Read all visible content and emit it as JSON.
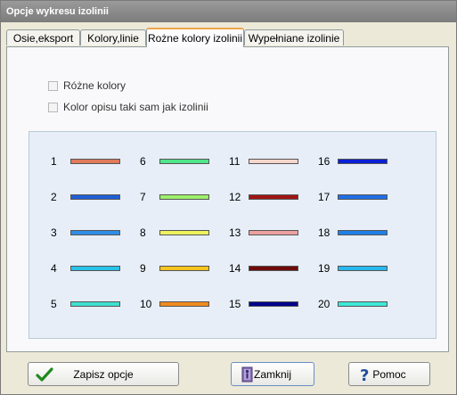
{
  "window": {
    "title": "Opcje wykresu izolinii"
  },
  "tabs": [
    {
      "label": "Osie,eksport",
      "active": false
    },
    {
      "label": "Kolory,linie",
      "active": false
    },
    {
      "label": "Rożne kolory izolinii",
      "active": true
    },
    {
      "label": "Wypełniane izolinie",
      "active": false
    }
  ],
  "options": {
    "different_colors": {
      "label": "Różne kolory",
      "checked": false
    },
    "label_color_same": {
      "label": "Kolor opisu taki sam jak izolinii",
      "checked": false
    }
  },
  "swatches": [
    {
      "num": "1",
      "color": "#e07a5a"
    },
    {
      "num": "2",
      "color": "#1f5fd6"
    },
    {
      "num": "3",
      "color": "#2f8ee6"
    },
    {
      "num": "4",
      "color": "#27c3e8"
    },
    {
      "num": "5",
      "color": "#3ee0d0"
    },
    {
      "num": "6",
      "color": "#4fe58a"
    },
    {
      "num": "7",
      "color": "#9ef06a"
    },
    {
      "num": "8",
      "color": "#eef25c"
    },
    {
      "num": "9",
      "color": "#f5c51e"
    },
    {
      "num": "10",
      "color": "#f08a1e"
    },
    {
      "num": "11",
      "color": "#f6d6cc"
    },
    {
      "num": "12",
      "color": "#a01515"
    },
    {
      "num": "13",
      "color": "#eda0a0"
    },
    {
      "num": "14",
      "color": "#6e0a0a"
    },
    {
      "num": "15",
      "color": "#00008a"
    },
    {
      "num": "16",
      "color": "#0b1fd6"
    },
    {
      "num": "17",
      "color": "#1f6fe6"
    },
    {
      "num": "18",
      "color": "#1e7fe8"
    },
    {
      "num": "19",
      "color": "#27b8ee"
    },
    {
      "num": "20",
      "color": "#3ee8d8"
    }
  ],
  "buttons": {
    "save": {
      "label": "Zapisz opcje",
      "icon": "checkmark-icon"
    },
    "close": {
      "label": "Zamknij",
      "icon": "door-exit-icon"
    },
    "help": {
      "label": "Pomoc",
      "icon": "question-mark-icon"
    }
  }
}
